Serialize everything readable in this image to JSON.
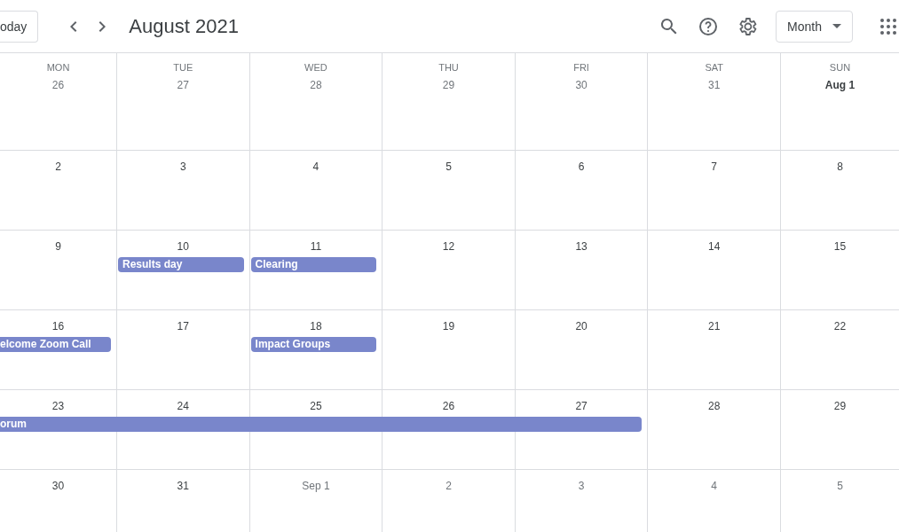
{
  "toolbar": {
    "today_button": "oday",
    "title": "August 2021",
    "view_select": "Month"
  },
  "weekdays": [
    "MON",
    "TUE",
    "WED",
    "THU",
    "FRI",
    "SAT",
    "SUN"
  ],
  "weeks": [
    {
      "days": [
        {
          "date": "26",
          "in_month": false
        },
        {
          "date": "27",
          "in_month": false
        },
        {
          "date": "28",
          "in_month": false
        },
        {
          "date": "29",
          "in_month": false
        },
        {
          "date": "30",
          "in_month": false
        },
        {
          "date": "31",
          "in_month": false
        },
        {
          "date": "Aug 1",
          "in_month": true
        }
      ]
    },
    {
      "days": [
        {
          "date": "2",
          "in_month": true
        },
        {
          "date": "3",
          "in_month": true
        },
        {
          "date": "4",
          "in_month": true
        },
        {
          "date": "5",
          "in_month": true
        },
        {
          "date": "6",
          "in_month": true
        },
        {
          "date": "7",
          "in_month": true
        },
        {
          "date": "8",
          "in_month": true
        }
      ]
    },
    {
      "days": [
        {
          "date": "9",
          "in_month": true
        },
        {
          "date": "10",
          "in_month": true,
          "event": {
            "title": "Results day",
            "cut_left": false,
            "color": "#7986cb"
          }
        },
        {
          "date": "11",
          "in_month": true,
          "event": {
            "title": "Clearing",
            "cut_left": false,
            "color": "#7986cb"
          }
        },
        {
          "date": "12",
          "in_month": true
        },
        {
          "date": "13",
          "in_month": true
        },
        {
          "date": "14",
          "in_month": true
        },
        {
          "date": "15",
          "in_month": true
        }
      ]
    },
    {
      "days": [
        {
          "date": "16",
          "in_month": true,
          "event": {
            "title": "elcome Zoom Call",
            "cut_left": true,
            "color": "#7986cb"
          }
        },
        {
          "date": "17",
          "in_month": true
        },
        {
          "date": "18",
          "in_month": true,
          "event": {
            "title": "Impact Groups",
            "cut_left": false,
            "color": "#7986cb"
          }
        },
        {
          "date": "19",
          "in_month": true
        },
        {
          "date": "20",
          "in_month": true
        },
        {
          "date": "21",
          "in_month": true
        },
        {
          "date": "22",
          "in_month": true
        }
      ]
    },
    {
      "days": [
        {
          "date": "23",
          "in_month": true,
          "event": {
            "title": "orum",
            "cut_left": true,
            "color": "#7986cb"
          }
        },
        {
          "date": "24",
          "in_month": true,
          "bar_continues": true
        },
        {
          "date": "25",
          "in_month": true,
          "bar_continues": true
        },
        {
          "date": "26",
          "in_month": true,
          "bar_continues": true
        },
        {
          "date": "27",
          "in_month": true,
          "bar_continues": true
        },
        {
          "date": "28",
          "in_month": true
        },
        {
          "date": "29",
          "in_month": true
        }
      ]
    },
    {
      "days": [
        {
          "date": "30",
          "in_month": true
        },
        {
          "date": "31",
          "in_month": true
        },
        {
          "date": "Sep 1",
          "in_month": false
        },
        {
          "date": "2",
          "in_month": false
        },
        {
          "date": "3",
          "in_month": false
        },
        {
          "date": "4",
          "in_month": false
        },
        {
          "date": "5",
          "in_month": false
        }
      ]
    }
  ]
}
